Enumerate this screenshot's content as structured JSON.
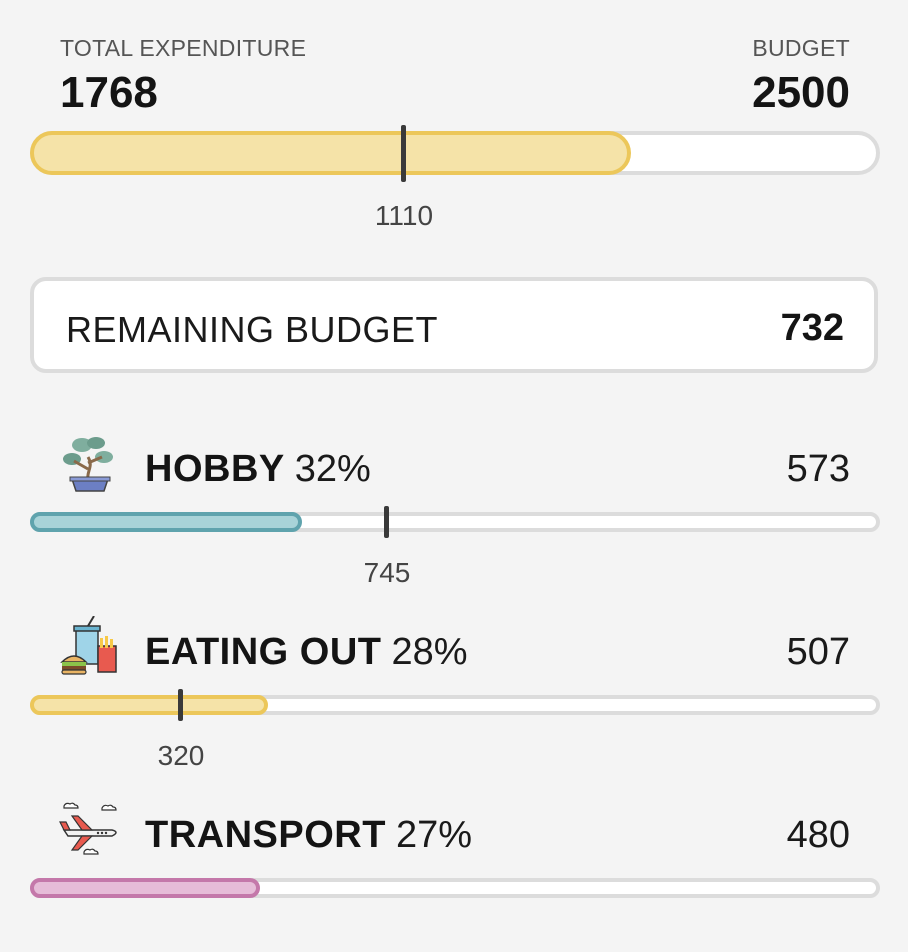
{
  "summary": {
    "expenditure_label": "TOTAL EXPENDITURE",
    "expenditure_value": "1768",
    "budget_label": "BUDGET",
    "budget_value": "2500",
    "progress_fraction": 0.707,
    "marker_label": "1110",
    "fill_color": "#f5e3a8",
    "fill_border": "#ecc75a"
  },
  "remaining": {
    "label": "REMAINING BUDGET",
    "value": "732"
  },
  "categories": [
    {
      "icon": "bonsai-icon",
      "name": "HOBBY",
      "percent": "32%",
      "value": "573",
      "marker_label": "745",
      "fill_color": "#a8d3d8",
      "border_color": "#5fa3ad",
      "progress_fraction": 0.32
    },
    {
      "icon": "fast-food-icon",
      "name": "EATING OUT",
      "percent": "28%",
      "value": "507",
      "marker_label": "320",
      "fill_color": "#f5e3a8",
      "border_color": "#ecc75a",
      "progress_fraction": 0.28
    },
    {
      "icon": "airplane-icon",
      "name": "TRANSPORT",
      "percent": "27%",
      "value": "480",
      "fill_color": "#e6bcd8",
      "border_color": "#c478aa",
      "progress_fraction": 0.27
    }
  ]
}
